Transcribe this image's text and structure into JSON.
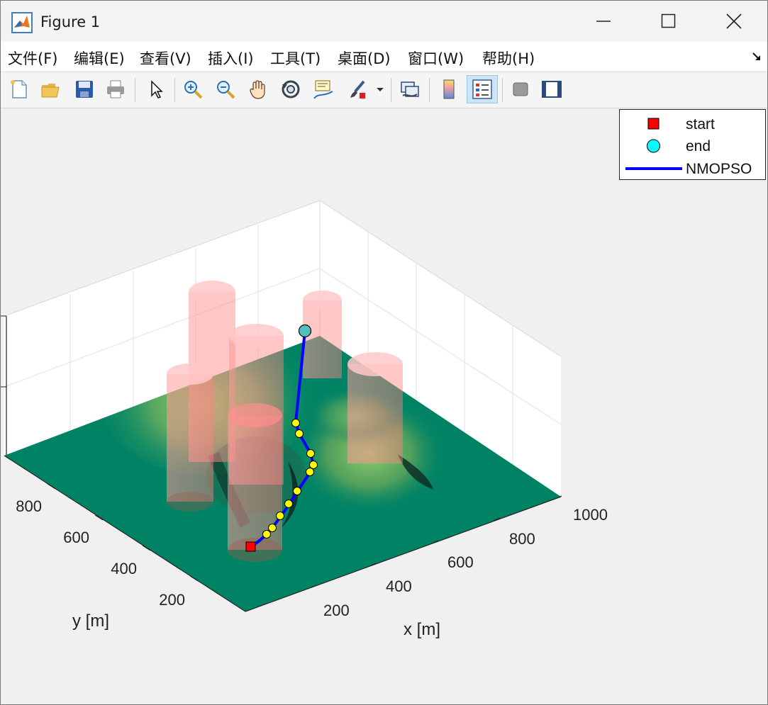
{
  "window": {
    "title": "Figure 1"
  },
  "menu": [
    "文件(F)",
    "编辑(E)",
    "查看(V)",
    "插入(I)",
    "工具(T)",
    "桌面(D)",
    "窗口(W)",
    "帮助(H)"
  ],
  "toolbar_icons": [
    "new-figure-icon",
    "open-file-icon",
    "save-icon",
    "print-icon",
    "pointer-icon",
    "zoom-in-icon",
    "zoom-out-icon",
    "pan-hand-icon",
    "rotate-3d-icon",
    "data-cursor-icon",
    "brush-icon",
    "brush-dropdown-icon",
    "link-plot-icon",
    "colorbar-icon",
    "legend-icon",
    "hide-plot-tools-icon",
    "show-plot-tools-icon"
  ],
  "legend": {
    "start": "start",
    "end": "end",
    "path": "NMOPSO"
  },
  "colors": {
    "start": "#ff0000",
    "end": "#00ffff",
    "path": "#0000ff",
    "waypoint": "#ffff00",
    "obstacle": "#ff8080",
    "terrain_low": "#008060",
    "terrain_high": "#88c86a"
  },
  "axes": {
    "x_label": "x [m]",
    "y_label": "y [m]",
    "x_ticks": [
      "200",
      "400",
      "600",
      "800",
      "1000"
    ],
    "y_ticks": [
      "200",
      "400",
      "600",
      "800"
    ]
  },
  "chart_data": {
    "type": "surface-3d",
    "xlabel": "x [m]",
    "ylabel": "y [m]",
    "series": [
      {
        "name": "start",
        "marker": "square"
      },
      {
        "name": "end",
        "marker": "circle"
      },
      {
        "name": "NMOPSO",
        "line": "solid"
      }
    ]
  }
}
